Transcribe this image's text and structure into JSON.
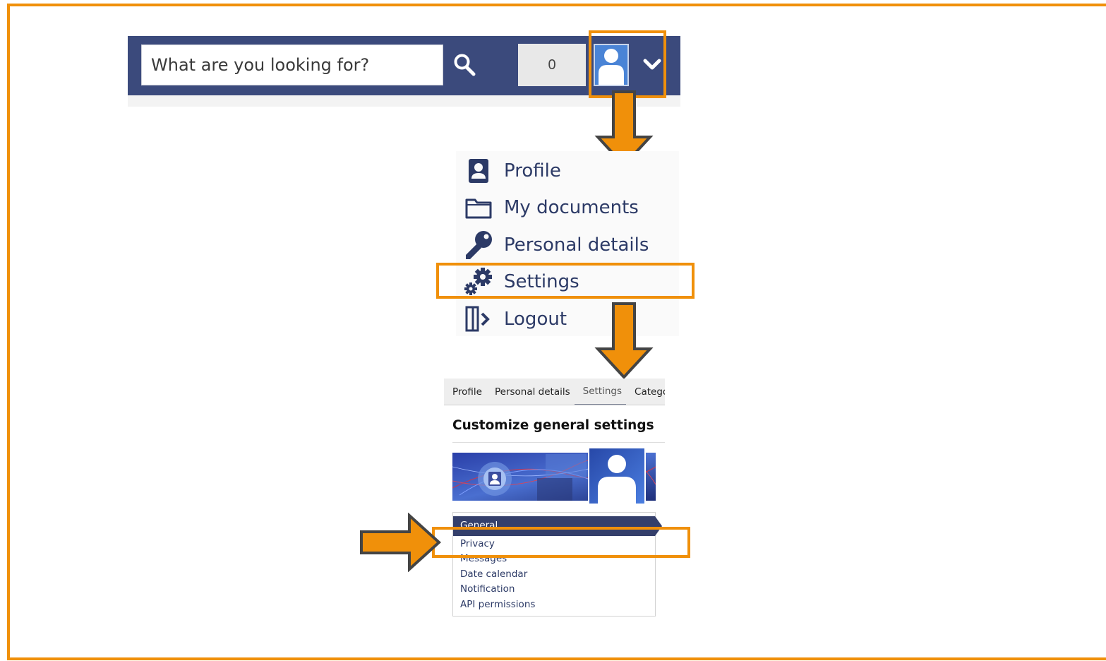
{
  "header": {
    "search_placeholder": "What are you looking for?",
    "counter": "0"
  },
  "menu": {
    "items": [
      {
        "label": "Profile",
        "icon": "profile-icon"
      },
      {
        "label": "My documents",
        "icon": "folder-icon"
      },
      {
        "label": "Personal details",
        "icon": "key-icon"
      },
      {
        "label": "Settings",
        "icon": "gears-icon"
      },
      {
        "label": "Logout",
        "icon": "logout-icon"
      }
    ]
  },
  "settings": {
    "tabs": [
      {
        "label": "Profile"
      },
      {
        "label": "Personal details"
      },
      {
        "label": "Settings"
      },
      {
        "label": "Categor"
      }
    ],
    "active_tab": "Settings",
    "title": "Customize general settings",
    "sidebar": [
      {
        "label": "General"
      },
      {
        "label": "Privacy"
      },
      {
        "label": "Messages"
      },
      {
        "label": "Date calendar"
      },
      {
        "label": "Notification"
      },
      {
        "label": "API permissions"
      }
    ]
  },
  "colors": {
    "highlight": "#f0900a",
    "navbar": "#3b4a7c",
    "menu_text": "#2c3a66",
    "active_item": "#343f6b"
  }
}
